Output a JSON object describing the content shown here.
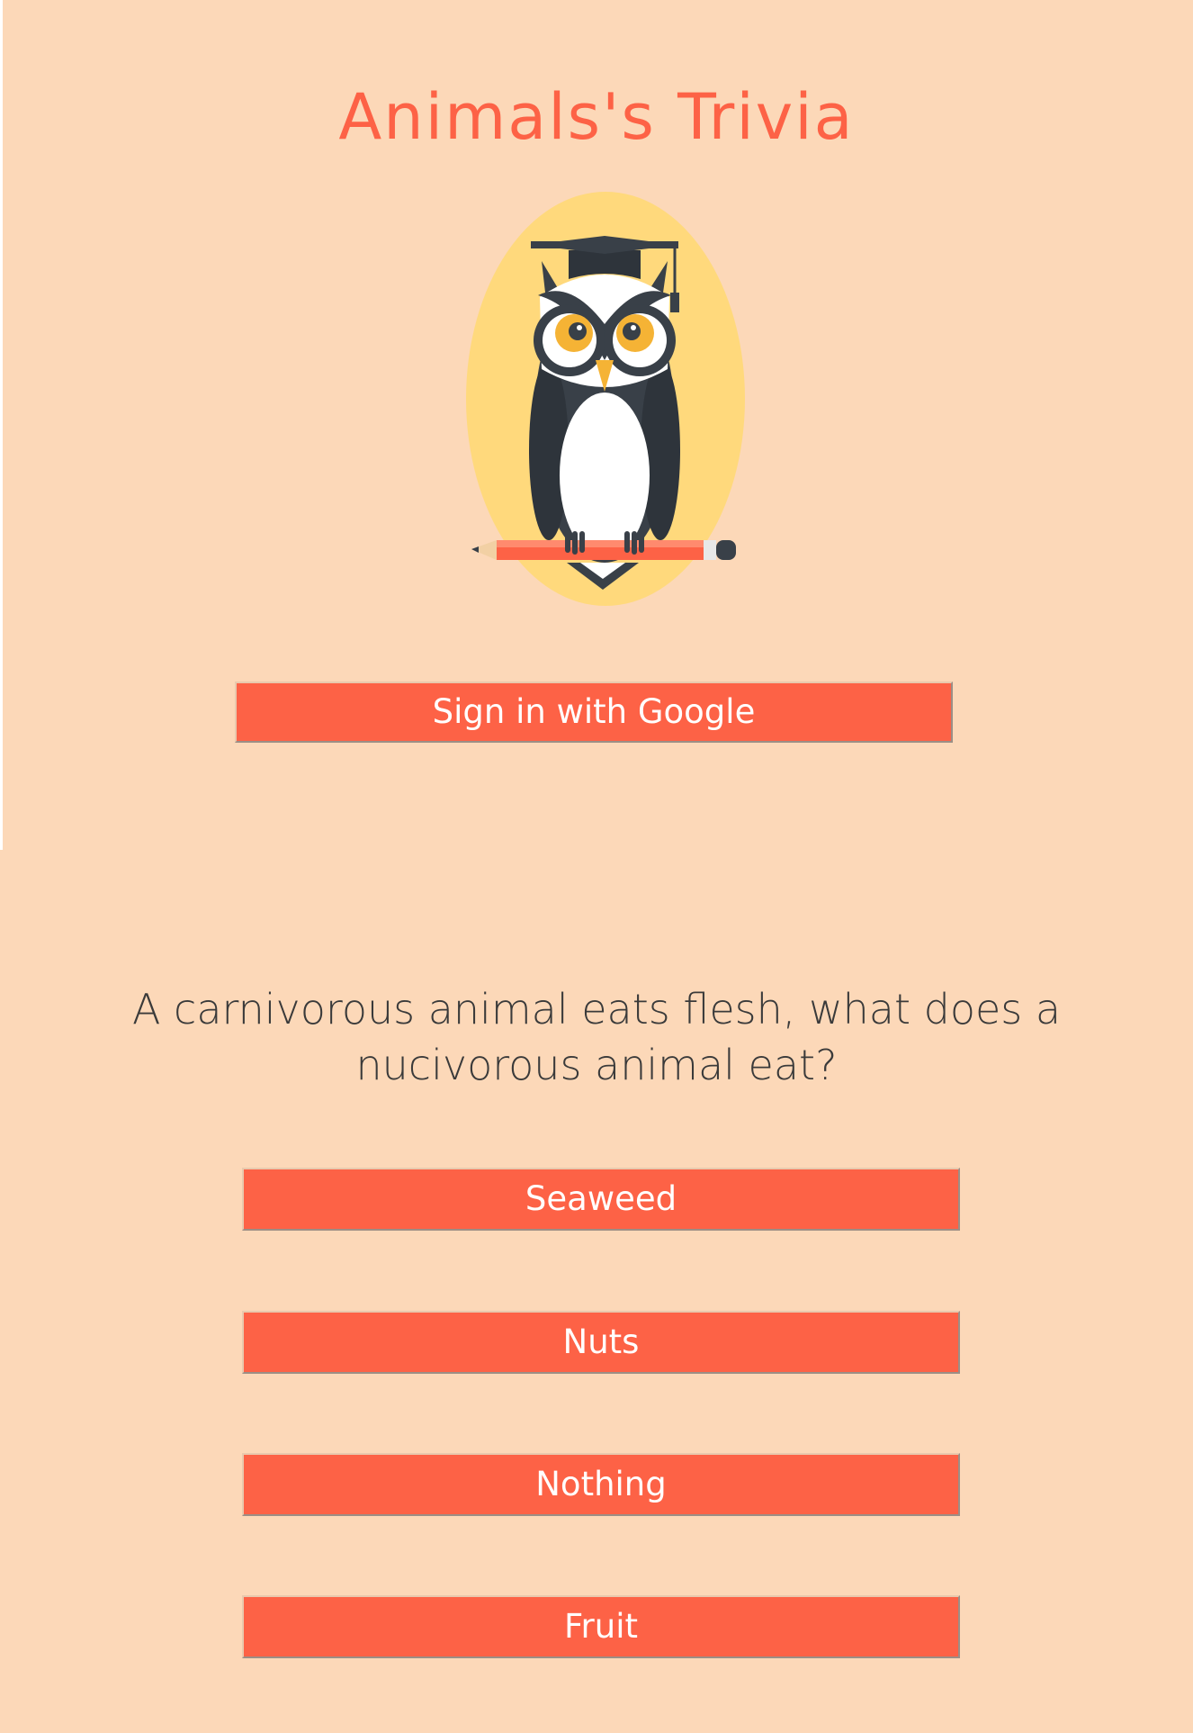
{
  "app": {
    "title": "Animals's Trivia"
  },
  "auth": {
    "signin_label": "Sign in with Google"
  },
  "quiz": {
    "question": "A carnivorous animal eats flesh, what does a nucivorous animal eat?",
    "answers": [
      {
        "label": "Seaweed"
      },
      {
        "label": "Nuts"
      },
      {
        "label": "Nothing"
      },
      {
        "label": "Fruit"
      }
    ]
  },
  "colors": {
    "background": "#fcd8b8",
    "accent": "#fd6246",
    "logo_circle": "#ffd97c",
    "owl_dark": "#394048"
  },
  "icons": {
    "logo": "owl-graduate-icon"
  }
}
